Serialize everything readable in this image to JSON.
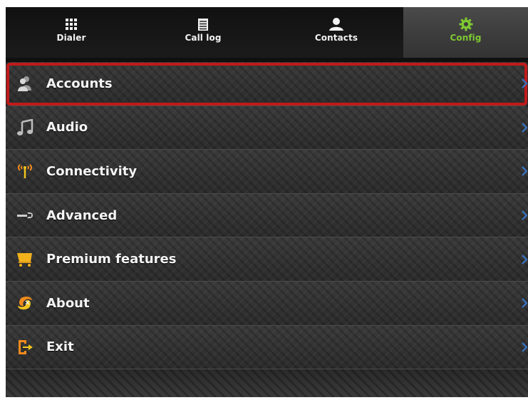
{
  "tabs": [
    {
      "label": "Dialer",
      "icon": "keypad-icon"
    },
    {
      "label": "Call log",
      "icon": "list-icon"
    },
    {
      "label": "Contacts",
      "icon": "person-icon"
    },
    {
      "label": "Config",
      "icon": "gear-icon",
      "active": true
    }
  ],
  "menu": {
    "items": [
      {
        "label": "Accounts",
        "icon": "accounts-icon",
        "selected": true
      },
      {
        "label": "Audio",
        "icon": "music-note-icon"
      },
      {
        "label": "Connectivity",
        "icon": "antenna-icon"
      },
      {
        "label": "Advanced",
        "icon": "wrench-icon"
      },
      {
        "label": "Premium features",
        "icon": "cart-icon"
      },
      {
        "label": "About",
        "icon": "about-icon"
      },
      {
        "label": "Exit",
        "icon": "exit-icon"
      }
    ]
  },
  "colors": {
    "active_tab_text": "#7ec832",
    "selection_outline": "#c11a1a",
    "chevron": "#3b6fb6"
  }
}
